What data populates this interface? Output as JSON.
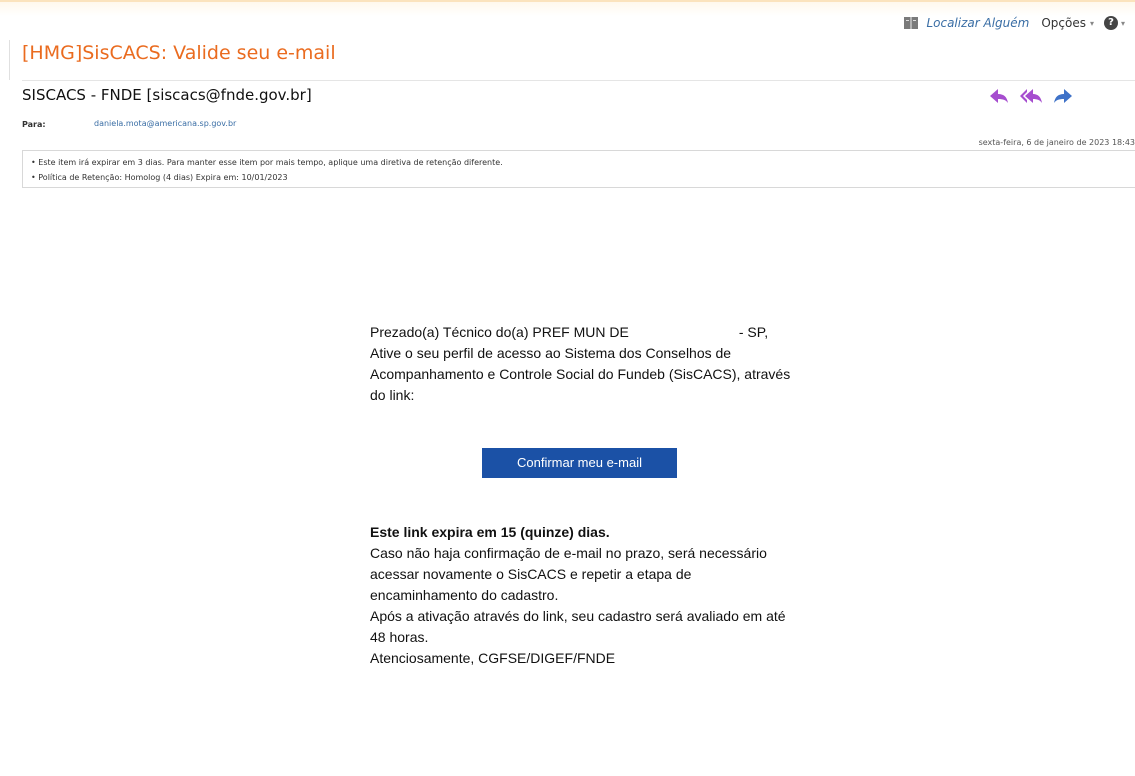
{
  "toolbar": {
    "find_someone": "Localizar Alguém",
    "options": "Opções",
    "options_caret": "▾",
    "help_glyph": "?",
    "help_caret": "▾",
    "icons": [
      "address-book-icon",
      "help-icon"
    ]
  },
  "message": {
    "subject": "[HMG]SisCACS: Valide seu e-mail",
    "sender": "SISCACS - FNDE [siscacs@fnde.gov.br]",
    "to_label": "Para:",
    "to_value": "daniela.mota@americana.sp.gov.br",
    "date": "sexta-feira, 6 de janeiro de 2023 18:43",
    "actions": [
      "reply-icon",
      "reply-all-icon",
      "forward-icon"
    ],
    "notices": [
      "• Este item irá expirar em 3 dias. Para manter esse item por mais tempo, aplique uma diretiva de retenção diferente.",
      "• Política de Retenção: Homolog (4 dias) Expira em: 10/01/2023"
    ]
  },
  "body": {
    "greeting_prefix": "Prezado(a) Técnico do(a) PREF MUN DE",
    "greeting_suffix": "- SP,",
    "intro": "Ative o seu perfil de acesso ao Sistema dos Conselhos de Acompanhamento e Controle Social do Fundeb (SisCACS), através do link:",
    "button": "Confirmar meu e-mail",
    "expiry_title": "Este link expira em 15 (quinze) dias.",
    "expiry_text": "Caso não haja confirmação de e-mail no prazo, será necessário acessar novamente o SisCACS e repetir a etapa de encaminhamento do cadastro.",
    "evaluation_text": "Após a ativação através do link, seu cadastro será avaliado em até 48 horas.",
    "signature": "Atenciosamente, CGFSE/DIGEF/FNDE"
  },
  "colors": {
    "subject": "#ea6b1f",
    "link": "#3a6ea5",
    "button_bg": "#1b51a6",
    "action_icons": "#a64dcf"
  }
}
